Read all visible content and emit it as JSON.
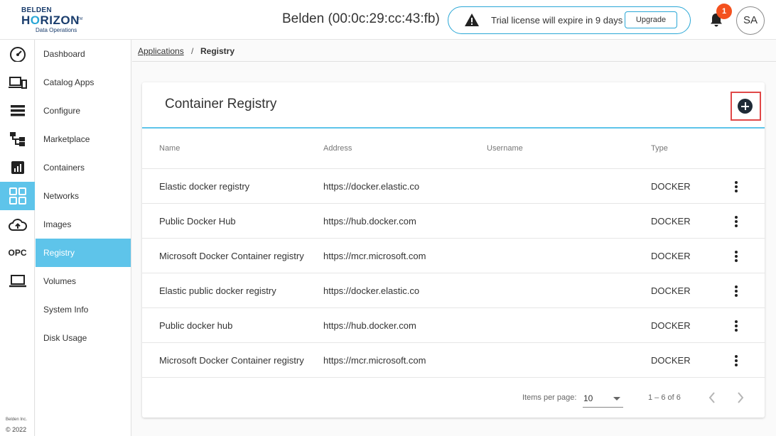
{
  "header": {
    "logo": {
      "brand": "BELDEN",
      "product_pre": "H",
      "product_o": "O",
      "product_post": "RIZON",
      "tm": "TM",
      "sub": "Data Operations"
    },
    "device_title": "Belden (00:0c:29:cc:43:fb)",
    "license_text": "Trial license will expire in 9 days",
    "upgrade_label": "Upgrade",
    "notification_count": "1",
    "avatar_initials": "SA"
  },
  "rail": {
    "icons": [
      "gauge-icon",
      "devices-icon",
      "list-icon",
      "hierarchy-icon",
      "chart-icon",
      "apps-grid-icon",
      "cloud-upload-icon",
      "opc-icon",
      "laptop-icon"
    ],
    "opc_label": "OPC",
    "footer_company": "Belden Inc.",
    "footer_year": "© 2022"
  },
  "sidebar": {
    "items": [
      {
        "label": "Dashboard"
      },
      {
        "label": "Catalog Apps"
      },
      {
        "label": "Configure"
      },
      {
        "label": "Marketplace"
      },
      {
        "label": "Containers"
      },
      {
        "label": "Networks"
      },
      {
        "label": "Images"
      },
      {
        "label": "Registry"
      },
      {
        "label": "Volumes"
      },
      {
        "label": "System Info"
      },
      {
        "label": "Disk Usage"
      }
    ],
    "active": "Registry"
  },
  "breadcrumb": {
    "link": "Applications",
    "sep": "/",
    "current": "Registry"
  },
  "card": {
    "title": "Container Registry",
    "columns": [
      "Name",
      "Address",
      "Username",
      "Type"
    ],
    "rows": [
      {
        "name": "Elastic docker registry",
        "address": "https://docker.elastic.co",
        "username": "",
        "type": "DOCKER"
      },
      {
        "name": "Public Docker Hub",
        "address": "https://hub.docker.com",
        "username": "",
        "type": "DOCKER"
      },
      {
        "name": "Microsoft Docker Container registry",
        "address": "https://mcr.microsoft.com",
        "username": "",
        "type": "DOCKER"
      },
      {
        "name": "Elastic public docker registry",
        "address": "https://docker.elastic.co",
        "username": "",
        "type": "DOCKER"
      },
      {
        "name": "Public docker hub",
        "address": "https://hub.docker.com",
        "username": "",
        "type": "DOCKER"
      },
      {
        "name": "Microsoft Docker Container registry",
        "address": "https://mcr.microsoft.com",
        "username": "",
        "type": "DOCKER"
      }
    ]
  },
  "pagination": {
    "items_per_page_label": "Items per page:",
    "items_per_page": "10",
    "range": "1 – 6 of 6"
  },
  "colors": {
    "accent": "#5ec4ea",
    "brand": "#1a3d6d",
    "badge": "#f4511e",
    "highlight": "#e04848"
  }
}
